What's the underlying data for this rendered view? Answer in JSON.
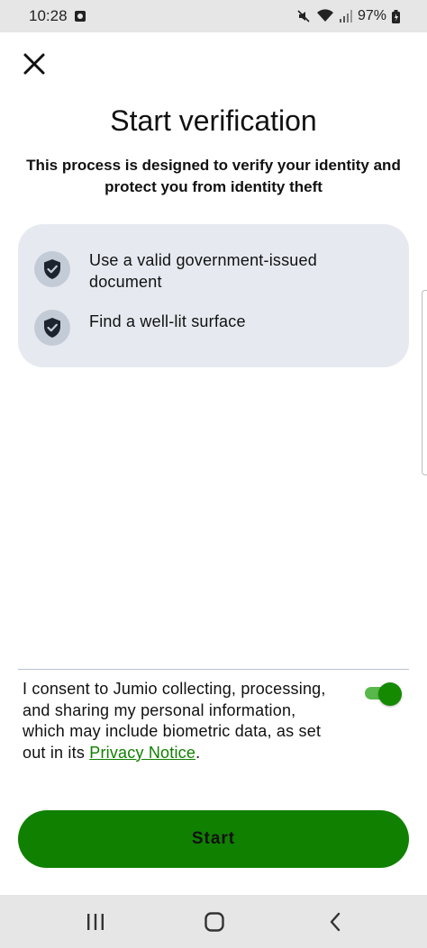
{
  "status_bar": {
    "time": "10:28",
    "battery": "97%",
    "icons": [
      "app-notification-icon",
      "mute-icon",
      "wifi-icon",
      "signal-icon",
      "battery-icon"
    ]
  },
  "header": {
    "close_icon": "close-icon",
    "title": "Start verification",
    "subtitle": "This process is designed to verify your identity and protect you from identity theft"
  },
  "requirements": [
    {
      "icon": "shield-check-icon",
      "label": "Use a valid government-issued document"
    },
    {
      "icon": "shield-check-icon",
      "label": "Find a well-lit surface"
    }
  ],
  "consent": {
    "text": "I consent to Jumio collecting, processing, and sharing my personal information, which may include biometric data, as set out in its ",
    "link_label": "Privacy Notice",
    "trailing": ".",
    "toggle_on": true
  },
  "start_button": {
    "label": "Start"
  },
  "nav_bar": {
    "icons": [
      "recents-icon",
      "home-icon",
      "back-icon"
    ]
  },
  "colors": {
    "primary": "#108000",
    "card_background": "#e6eaf0",
    "icon_circle": "#c3cbd6",
    "toggle_track": "#59b84a",
    "system_bar": "#e6e6e6"
  }
}
